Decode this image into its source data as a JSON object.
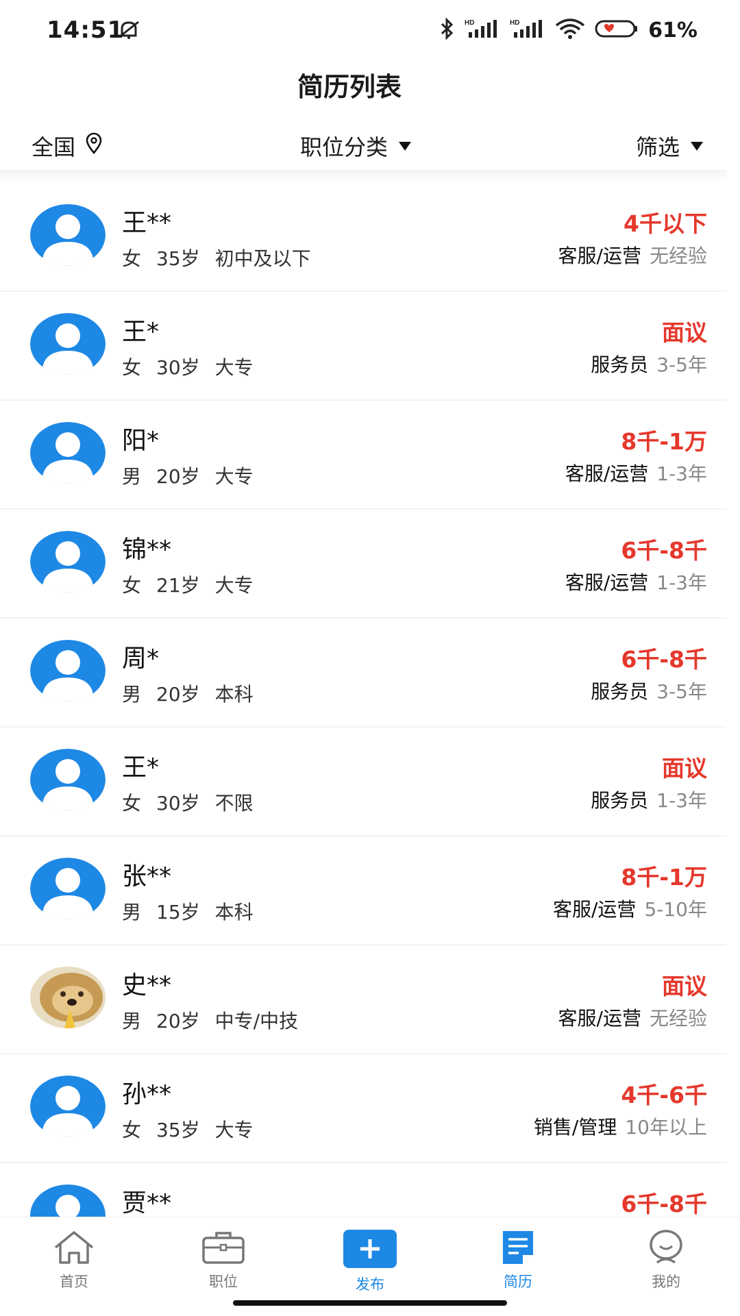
{
  "status_bar": {
    "time": "14:51",
    "battery": "61%",
    "icons": [
      "mute-icon",
      "bluetooth-icon",
      "signal-hd-icon",
      "signal-hd-icon",
      "wifi-icon",
      "battery-icon"
    ]
  },
  "header": {
    "title": "简历列表"
  },
  "filters": {
    "region": "全国",
    "category": "职位分类",
    "filter": "筛选"
  },
  "resumes": [
    {
      "name": "王**",
      "gender": "女",
      "age": "35岁",
      "education": "初中及以下",
      "salary": "4千以下",
      "job": "客服/运营",
      "experience": "无经验",
      "avatar": "default"
    },
    {
      "name": "王*",
      "gender": "女",
      "age": "30岁",
      "education": "大专",
      "salary": "面议",
      "job": "服务员",
      "experience": "3-5年",
      "avatar": "default"
    },
    {
      "name": "阳*",
      "gender": "男",
      "age": "20岁",
      "education": "大专",
      "salary": "8千-1万",
      "job": "客服/运营",
      "experience": "1-3年",
      "avatar": "default"
    },
    {
      "name": "锦**",
      "gender": "女",
      "age": "21岁",
      "education": "大专",
      "salary": "6千-8千",
      "job": "客服/运营",
      "experience": "1-3年",
      "avatar": "default"
    },
    {
      "name": "周*",
      "gender": "男",
      "age": "20岁",
      "education": "本科",
      "salary": "6千-8千",
      "job": "服务员",
      "experience": "3-5年",
      "avatar": "default"
    },
    {
      "name": "王*",
      "gender": "女",
      "age": "30岁",
      "education": "不限",
      "salary": "面议",
      "job": "服务员",
      "experience": "1-3年",
      "avatar": "default"
    },
    {
      "name": "张**",
      "gender": "男",
      "age": "15岁",
      "education": "本科",
      "salary": "8千-1万",
      "job": "客服/运营",
      "experience": "5-10年",
      "avatar": "default"
    },
    {
      "name": "史**",
      "gender": "男",
      "age": "20岁",
      "education": "中专/中技",
      "salary": "面议",
      "job": "客服/运营",
      "experience": "无经验",
      "avatar": "photo"
    },
    {
      "name": "孙**",
      "gender": "女",
      "age": "35岁",
      "education": "大专",
      "salary": "4千-6千",
      "job": "销售/管理",
      "experience": "10年以上",
      "avatar": "default"
    },
    {
      "name": "贾**",
      "gender": "",
      "age": "",
      "education": "",
      "salary": "6千-8千",
      "job": "",
      "experience": "",
      "avatar": "default"
    }
  ],
  "nav": [
    {
      "label": "首页",
      "icon": "home-icon",
      "active": false
    },
    {
      "label": "职位",
      "icon": "briefcase-icon",
      "active": false
    },
    {
      "label": "发布",
      "icon": "plus-icon",
      "active": false
    },
    {
      "label": "简历",
      "icon": "resume-icon",
      "active": true
    },
    {
      "label": "我的",
      "icon": "profile-icon",
      "active": false
    }
  ],
  "colors": {
    "accent": "#1e88e5",
    "salary": "#e5382c",
    "text": "#1a1a1a",
    "muted": "#888888"
  }
}
